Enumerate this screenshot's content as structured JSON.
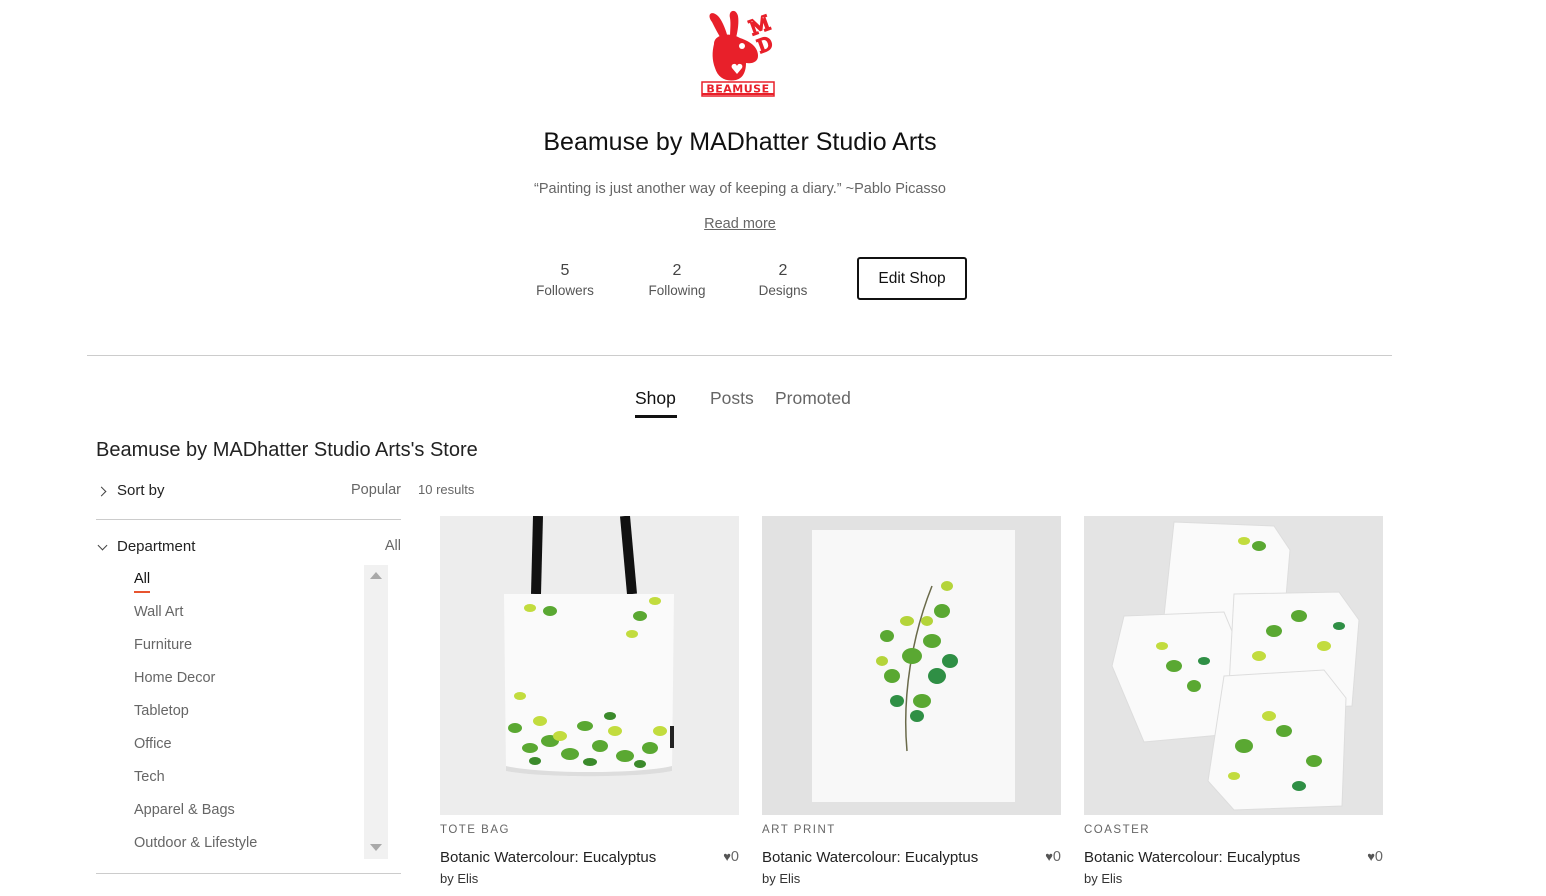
{
  "logo": {
    "text": "BEAMUSE",
    "monogram": "MD",
    "color": "#e8202a",
    "icon": "rabbit-head-logo"
  },
  "shop": {
    "name": "Beamuse by MADhatter Studio Arts",
    "tagline": "“Painting is just another way of keeping a diary.” ~Pablo Picasso",
    "read_more": "Read more"
  },
  "stats": [
    {
      "value": "5",
      "label": "Followers"
    },
    {
      "value": "2",
      "label": "Following"
    },
    {
      "value": "2",
      "label": "Designs"
    }
  ],
  "edit_button": "Edit Shop",
  "tabs": [
    {
      "label": "Shop",
      "active": true
    },
    {
      "label": "Posts",
      "active": false
    },
    {
      "label": "Promoted",
      "active": false
    }
  ],
  "store_title": "Beamuse by MADhatter Studio Arts's Store",
  "sort": {
    "label": "Sort by",
    "value": "Popular"
  },
  "results": "10 results",
  "department": {
    "label": "Department",
    "value": "All",
    "items": [
      "All",
      "Wall Art",
      "Furniture",
      "Home Decor",
      "Tabletop",
      "Office",
      "Tech",
      "Apparel & Bags",
      "Outdoor & Lifestyle"
    ],
    "selected": "All"
  },
  "products": [
    {
      "category": "TOTE BAG",
      "title": "Botanic Watercolour: Eucalyptus",
      "likes": "0",
      "artist": "by Elis",
      "image": "tote-bag-eucalyptus"
    },
    {
      "category": "ART PRINT",
      "title": "Botanic Watercolour: Eucalyptus",
      "likes": "0",
      "artist": "by Elis",
      "image": "art-print-eucalyptus"
    },
    {
      "category": "COASTER",
      "title": "Botanic Watercolour: Eucalyptus",
      "likes": "0",
      "artist": "by Elis",
      "image": "coaster-eucalyptus"
    }
  ],
  "colors": {
    "accent": "#e8542f",
    "brand": "#e8202a",
    "leaf_dark": "#3d8a2a",
    "leaf_light": "#b9d63a"
  }
}
